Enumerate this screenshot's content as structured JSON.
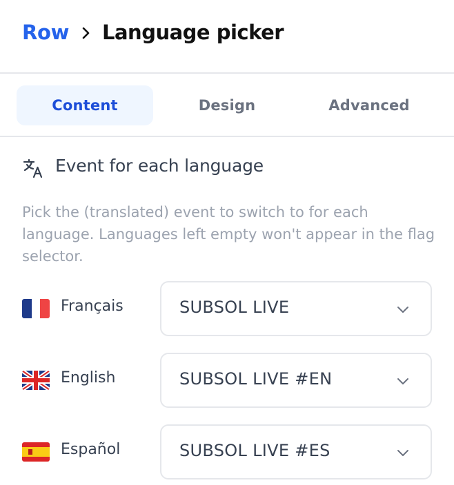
{
  "breadcrumb": {
    "root": "Row",
    "title": "Language picker"
  },
  "tabs": [
    {
      "label": "Content",
      "active": true
    },
    {
      "label": "Design",
      "active": false
    },
    {
      "label": "Advanced",
      "active": false
    }
  ],
  "section": {
    "icon": "translate-icon",
    "title": "Event for each language",
    "description": "Pick the (translated) event to switch to for each language. Languages left empty won't appear in the flag selector."
  },
  "languages": [
    {
      "label": "Français",
      "flag": "france-flag-icon",
      "selected_event": "SUBSOL LIVE"
    },
    {
      "label": "English",
      "flag": "uk-flag-icon",
      "selected_event": "SUBSOL LIVE #EN"
    },
    {
      "label": "Español",
      "flag": "spain-flag-icon",
      "selected_event": "SUBSOL LIVE #ES"
    }
  ],
  "colors": {
    "accent": "#2563eb",
    "active_tab_bg": "#eff6ff",
    "border": "#e5e7eb",
    "muted_text": "#9ca3af"
  }
}
